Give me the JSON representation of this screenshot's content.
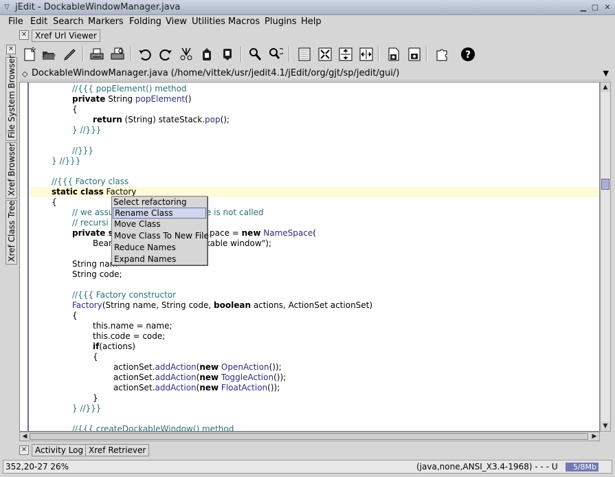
{
  "window": {
    "title": "jEdit - DockableWindowManager.java"
  },
  "menubar": {
    "items": [
      "File",
      "Edit",
      "Search",
      "Markers",
      "Folding",
      "View",
      "Utilities",
      "Macros",
      "Plugins",
      "Help"
    ]
  },
  "top_dock": {
    "tab": "Xref Url Viewer"
  },
  "left_dock": {
    "tabs": [
      "File System Browser",
      "Xref Browser",
      "Xref Class Tree"
    ]
  },
  "toolbar": {
    "icons": [
      "new-file-icon",
      "open-file-icon",
      "edit-pencil-icon",
      "print-icon",
      "print-preview-icon",
      "undo-icon",
      "redo-icon",
      "cut-icon",
      "copy-icon",
      "paste-icon",
      "search-icon",
      "search-replace-icon",
      "text-area-icon",
      "unsplit-icon",
      "split-horizontal-icon",
      "split-vertical-icon",
      "buffer-options-icon",
      "global-options-icon",
      "plugin-manager-icon",
      "help-icon"
    ]
  },
  "buffer": {
    "label": "DockableWindowManager.java (/home/vittek/usr/jedit4.1/jEdit/org/gjt/sp/jedit/gui/)"
  },
  "popup": {
    "title": "Select refactoring from:",
    "items": [
      "Rename Class",
      "Move Class",
      "Move Class To New File",
      "Reduce Names",
      "Expand Names"
    ],
    "selected": "Rename Class"
  },
  "bottom_dock": {
    "tabs": [
      "Activity Log",
      "Xref Retriever"
    ]
  },
  "status": {
    "caret": "352,20-27 26%",
    "mode": "(java,none,ANSI_X3.4-1968) - - - U",
    "memory": "5/8Mb"
  },
  "colors": {
    "comment": "#2a6f7a",
    "method": "#2b2b88",
    "highlight": "#fffad8",
    "selection": "#d2d6ec",
    "accent": "#6a6aa0"
  },
  "code": {
    "l1": "//{{{ popElement() method",
    "l2a": "private",
    "l2b": " String ",
    "l2c": "popElement",
    "l2d": "()",
    "l3": "{",
    "l4a": "return",
    "l4b": " (String) stateStack.",
    "l4c": "pop",
    "l4d": "();",
    "l5": "} //}}}",
    "l6": "//}}}",
    "l7": "} //}}}",
    "l8": "//{{{ Factory class",
    "l9a": "static class",
    "l9b": " Factory",
    "l10": "{",
    "l11a": "// we assu",
    "l11b": "ode is not called",
    "l12": "// recursi",
    "l13a": "private st",
    "l13b": "pace = ",
    "l13c": "new",
    "l13d": " NameSpace",
    "l13e": "(",
    "l14a": "Bean",
    "l14b": "ockable window\");",
    "l15": "String nam",
    "l16": "String code;",
    "l17": "//{{{ Factory constructor",
    "l18a": "Factory",
    "l18b": "(String name, String code, ",
    "l18c": "boolean",
    "l18d": " actions, ActionSet actionSet)",
    "l19": "{",
    "l20": "this.name = name;",
    "l21": "this.code = code;",
    "l22a": "if",
    "l22b": "(actions)",
    "l23": "{",
    "l24a": "actionSet.",
    "l24b": "addAction",
    "l24c": "(",
    "l24d": "new",
    "l24e": " OpenAction",
    "l24f": "());",
    "l25a": "actionSet.",
    "l25b": "addAction",
    "l25c": "(",
    "l25d": "new",
    "l25e": " ToggleAction",
    "l25f": "());",
    "l26a": "actionSet.",
    "l26b": "addAction",
    "l26c": "(",
    "l26d": "new",
    "l26e": " FloatAction",
    "l26f": "());",
    "l27": "}",
    "l28": "} //}}}",
    "l29": "//{{{ createDockableWindow() method"
  }
}
